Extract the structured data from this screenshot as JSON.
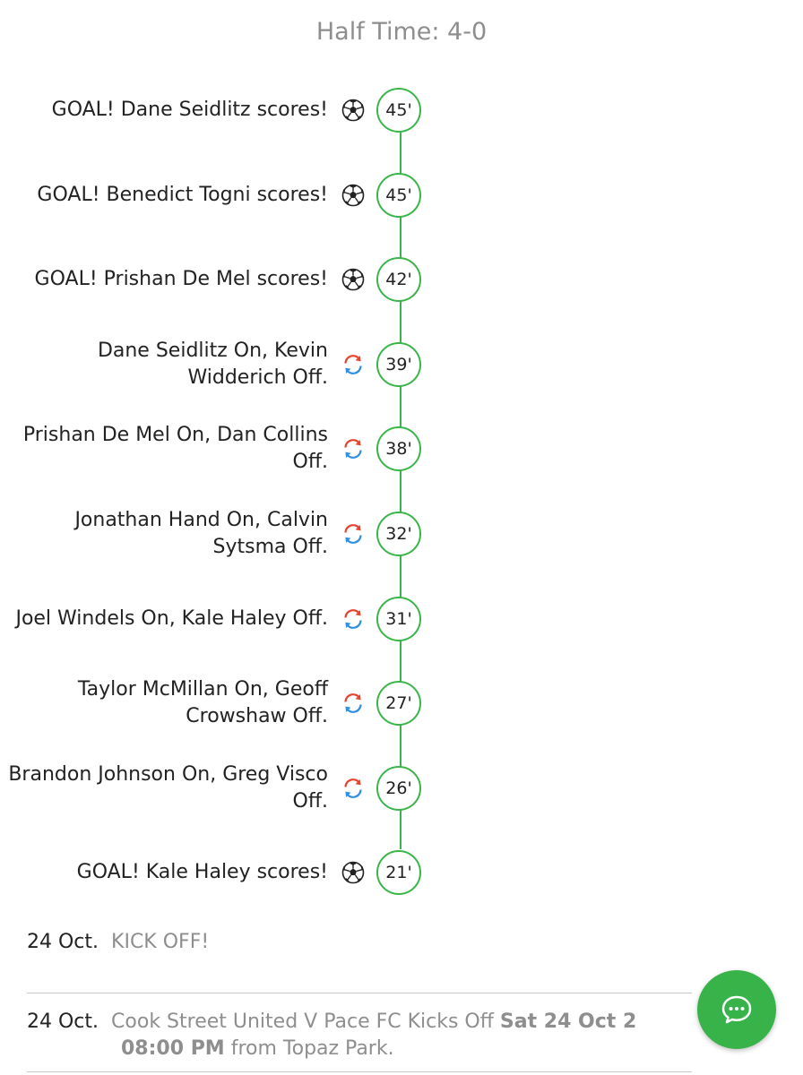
{
  "half_time": "Half Time: 4-0",
  "events": [
    {
      "text": "GOAL! Dane Seidlitz scores!",
      "type": "goal",
      "icon": "soccer-ball-icon",
      "minute": "45'"
    },
    {
      "text": "GOAL! Benedict Togni scores!",
      "type": "goal",
      "icon": "soccer-ball-icon",
      "minute": "45'"
    },
    {
      "text": "GOAL! Prishan De Mel scores!",
      "type": "goal",
      "icon": "soccer-ball-icon",
      "minute": "42'"
    },
    {
      "text": "Dane Seidlitz On, Kevin Widderich Off.",
      "type": "sub",
      "icon": "substitution-icon",
      "minute": "39'"
    },
    {
      "text": "Prishan De Mel On, Dan Collins Off.",
      "type": "sub",
      "icon": "substitution-icon",
      "minute": "38'"
    },
    {
      "text": "Jonathan Hand On, Calvin Sytsma Off.",
      "type": "sub",
      "icon": "substitution-icon",
      "minute": "32'"
    },
    {
      "text": "Joel Windels On, Kale Haley Off.",
      "type": "sub",
      "icon": "substitution-icon",
      "minute": "31'"
    },
    {
      "text": "Taylor McMillan On, Geoff Crowshaw Off.",
      "type": "sub",
      "icon": "substitution-icon",
      "minute": "27'"
    },
    {
      "text": "Brandon Johnson On, Greg Visco Off.",
      "type": "sub",
      "icon": "substitution-icon",
      "minute": "26'"
    },
    {
      "text": "GOAL! Kale Haley scores!",
      "type": "goal",
      "icon": "soccer-ball-icon",
      "minute": "21'"
    }
  ],
  "feed": [
    {
      "date": "24 Oct.",
      "text": "KICK OFF!"
    },
    {
      "date": "24 Oct.",
      "text_before": "Cook Street United V Pace FC Kicks Off ",
      "bold": "Sat 24 Oct 2",
      "line2_bold": "08:00 PM",
      "line2_text": " from Topaz Park."
    }
  ],
  "chat_button": {
    "icon": "chat-bubble-icon"
  },
  "colors": {
    "accent_green": "#3ab54a",
    "muted_text": "#8e8e8e",
    "sub_red": "#e8432e",
    "sub_blue": "#2f8fe0"
  }
}
